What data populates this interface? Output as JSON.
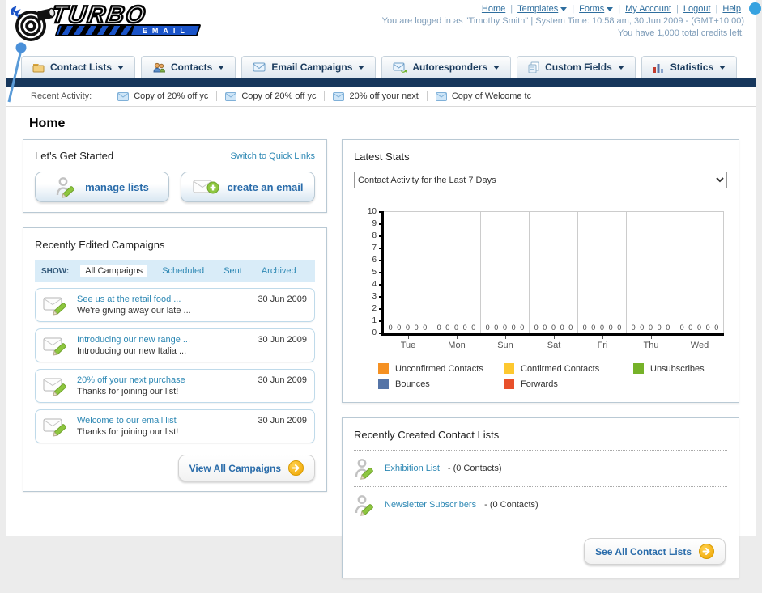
{
  "brand": {
    "name_top": "TURBO",
    "name_bottom": "EMAIL"
  },
  "topnav": {
    "links": [
      {
        "label": "Home",
        "dropdown": false
      },
      {
        "label": "Templates",
        "dropdown": true
      },
      {
        "label": "Forms",
        "dropdown": true
      },
      {
        "label": "My Account",
        "dropdown": false
      },
      {
        "label": "Logout",
        "dropdown": false
      },
      {
        "label": "Help",
        "dropdown": false
      }
    ]
  },
  "login_info": {
    "line1": "You are logged in as \"Timothy Smith\" | System Time: 10:58 am, 30 Jun 2009 - (GMT+10:00)",
    "line2": "You have 1,000 total credits left."
  },
  "tabs": [
    {
      "label": "Contact Lists",
      "icon": "folder"
    },
    {
      "label": "Contacts",
      "icon": "users"
    },
    {
      "label": "Email Campaigns",
      "icon": "mail"
    },
    {
      "label": "Autoresponders",
      "icon": "mail-arrow"
    },
    {
      "label": "Custom Fields",
      "icon": "fields"
    },
    {
      "label": "Statistics",
      "icon": "chart"
    }
  ],
  "recent_activity": {
    "label": "Recent Activity:",
    "items": [
      "Copy of 20% off yc",
      "Copy of 20% off yc",
      "20% off your next",
      "Copy of Welcome tc"
    ]
  },
  "page_title": "Home",
  "get_started": {
    "title": "Let's Get Started",
    "switch_link": "Switch to Quick Links",
    "buttons": [
      {
        "label": "manage lists",
        "icon": "person-pencil"
      },
      {
        "label": "create an email",
        "icon": "envelope-plus"
      }
    ]
  },
  "campaigns": {
    "title": "Recently Edited Campaigns",
    "show_label": "SHOW:",
    "filters": [
      "All Campaigns",
      "Scheduled",
      "Sent",
      "Archived"
    ],
    "active_filter": "All Campaigns",
    "items": [
      {
        "title": "See us at the retail food ...",
        "subtitle": "We're giving away our late ...",
        "date": "30 Jun 2009"
      },
      {
        "title": "Introducing our new range ...",
        "subtitle": "Introducing our new Italia ...",
        "date": "30 Jun 2009"
      },
      {
        "title": "20% off your next purchase",
        "subtitle": "Thanks for joining our list!",
        "date": "30 Jun 2009"
      },
      {
        "title": "Welcome to our email list",
        "subtitle": "Thanks for joining our list!",
        "date": "30 Jun 2009"
      }
    ],
    "view_all_label": "View All Campaigns"
  },
  "stats": {
    "title": "Latest Stats",
    "dropdown_value": "Contact Activity for the Last 7 Days",
    "chart_data": {
      "type": "bar",
      "title": "Contact Activity for the Last 7 Days",
      "categories": [
        "Tue",
        "Mon",
        "Sun",
        "Sat",
        "Fri",
        "Thu",
        "Wed"
      ],
      "series": [
        {
          "name": "Unconfirmed Contacts",
          "color": "#f59123",
          "values": [
            0,
            0,
            0,
            0,
            0,
            0,
            0
          ]
        },
        {
          "name": "Confirmed Contacts",
          "color": "#fdc82f",
          "values": [
            0,
            0,
            0,
            0,
            0,
            0,
            0
          ]
        },
        {
          "name": "Unsubscribes",
          "color": "#76b229",
          "values": [
            0,
            0,
            0,
            0,
            0,
            0,
            0
          ]
        },
        {
          "name": "Bounces",
          "color": "#5574a7",
          "values": [
            0,
            0,
            0,
            0,
            0,
            0,
            0
          ]
        },
        {
          "name": "Forwards",
          "color": "#e8502b",
          "values": [
            0,
            0,
            0,
            0,
            0,
            0,
            0
          ]
        }
      ],
      "ylim": [
        0,
        10
      ],
      "yticks": [
        0,
        1,
        2,
        3,
        4,
        5,
        6,
        7,
        8,
        9,
        10
      ],
      "grid": "vertical",
      "legend_position": "bottom"
    }
  },
  "contact_lists": {
    "title": "Recently Created Contact Lists",
    "items": [
      {
        "name": "Exhibition List",
        "detail": " - (0 Contacts)"
      },
      {
        "name": "Newsletter Subscribers",
        "detail": " - (0 Contacts)"
      }
    ],
    "see_all_label": "See All Contact Lists"
  }
}
